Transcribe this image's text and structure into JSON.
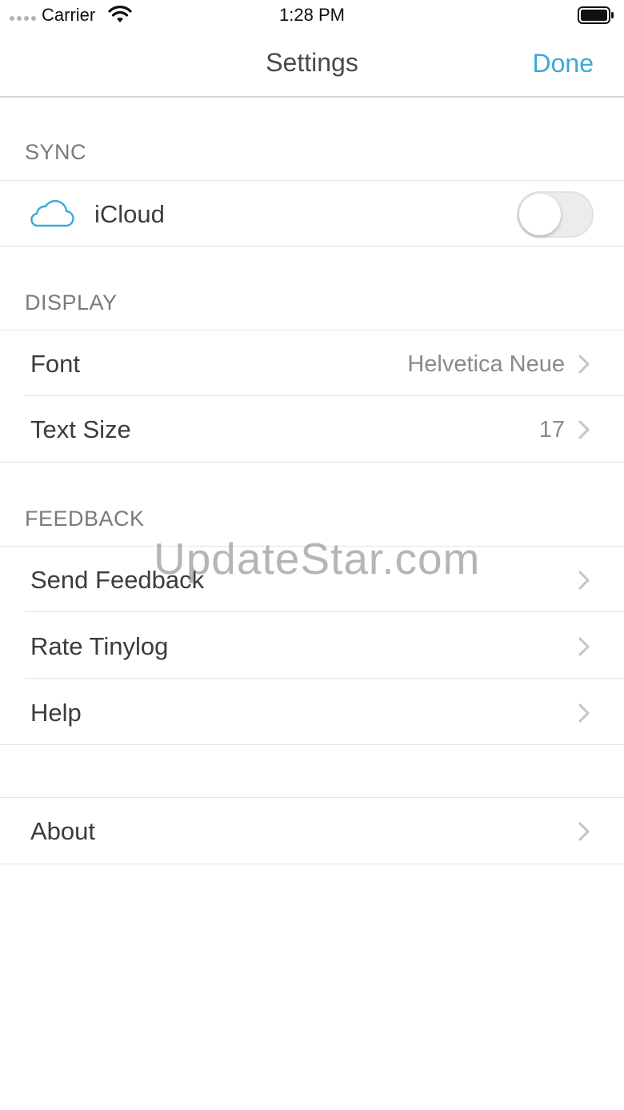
{
  "status_bar": {
    "carrier": "Carrier",
    "time": "1:28 PM"
  },
  "nav": {
    "title": "Settings",
    "done_label": "Done"
  },
  "sync": {
    "header": "SYNC",
    "icloud": {
      "label": "iCloud",
      "enabled": false,
      "icon": "cloud-icon"
    }
  },
  "display": {
    "header": "DISPLAY",
    "font": {
      "label": "Font",
      "value": "Helvetica Neue"
    },
    "text_size": {
      "label": "Text Size",
      "value": "17"
    }
  },
  "feedback": {
    "header": "FEEDBACK",
    "items": [
      {
        "label": "Send Feedback"
      },
      {
        "label": "Rate Tinylog"
      },
      {
        "label": "Help"
      }
    ]
  },
  "about": {
    "label": "About"
  },
  "watermark": "UpdateStar.com",
  "colors": {
    "accent": "#3aa9d8",
    "cloud": "#3aa9d8",
    "separator": "#e4e4e4"
  }
}
